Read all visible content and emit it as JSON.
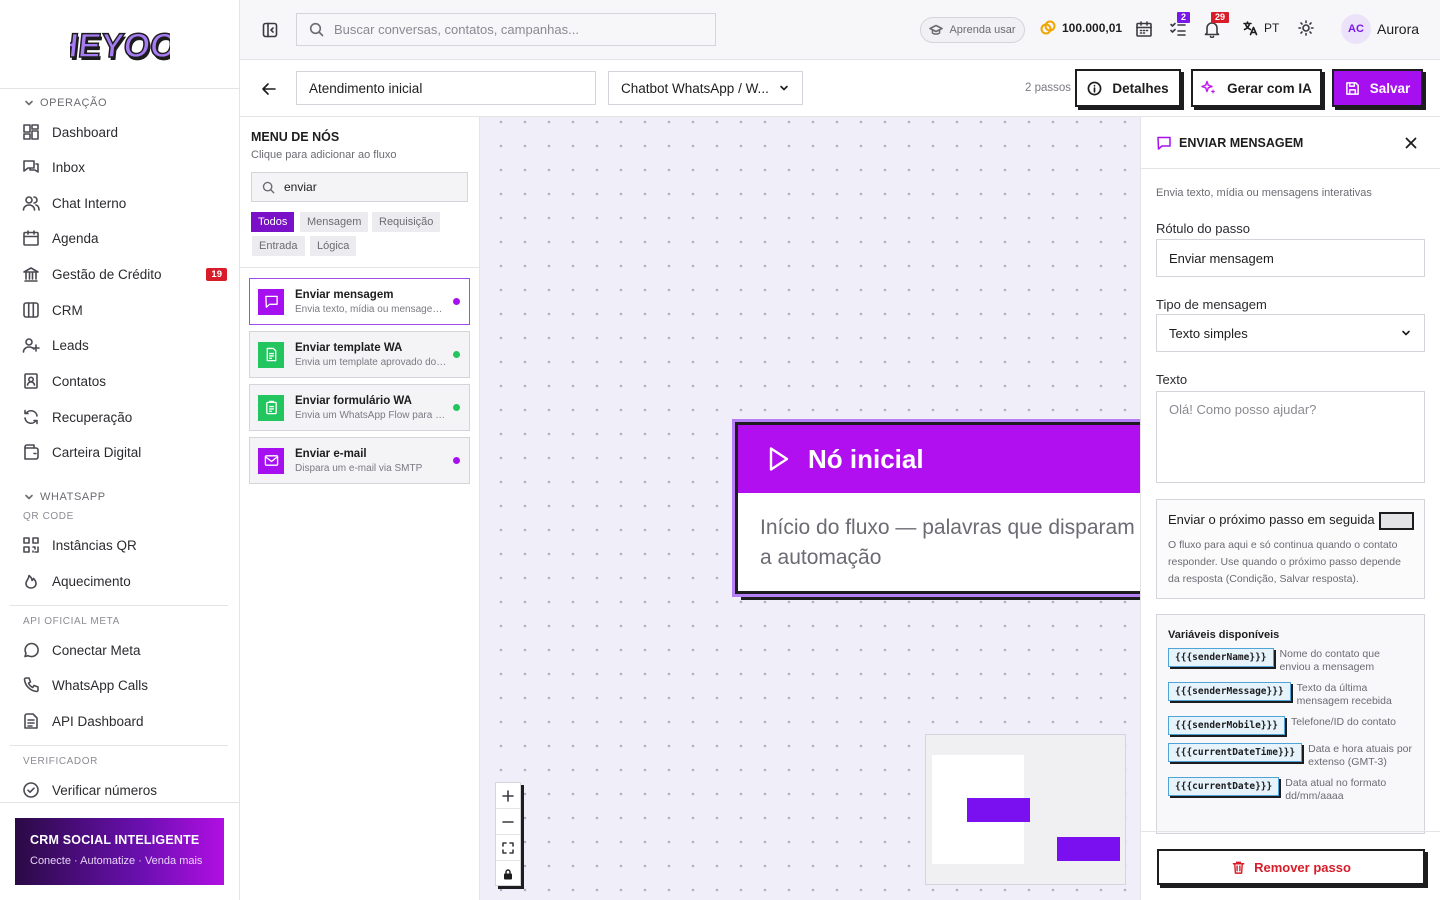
{
  "brand": {
    "logo": "HEYOO"
  },
  "colors": {
    "accent": "#a610f0",
    "accent_dark": "#7a10c8",
    "danger": "#d71d2a"
  },
  "sidebar": {
    "sections": [
      {
        "title": "OPERAÇÃO"
      },
      {
        "title": "WHATSAPP"
      }
    ],
    "subtitles": [
      "QR CODE",
      "API OFICIAL META",
      "VERIFICADOR"
    ],
    "items": [
      {
        "label": "Dashboard",
        "icon": "dashboard-icon"
      },
      {
        "label": "Inbox",
        "icon": "inbox-icon"
      },
      {
        "label": "Chat Interno",
        "icon": "users-icon"
      },
      {
        "label": "Agenda",
        "icon": "calendar-icon"
      },
      {
        "label": "Gestão de Crédito",
        "icon": "bank-icon",
        "badge": "19"
      },
      {
        "label": "CRM",
        "icon": "columns-icon"
      },
      {
        "label": "Leads",
        "icon": "user-plus-icon"
      },
      {
        "label": "Contatos",
        "icon": "contact-icon"
      },
      {
        "label": "Recuperação",
        "icon": "refresh-icon"
      },
      {
        "label": "Carteira Digital",
        "icon": "wallet-icon"
      },
      {
        "label": "Instâncias QR",
        "icon": "qr-icon"
      },
      {
        "label": "Aquecimento",
        "icon": "flame-icon"
      },
      {
        "label": "Conectar Meta",
        "icon": "whatsapp-icon"
      },
      {
        "label": "WhatsApp Calls",
        "icon": "phone-icon"
      },
      {
        "label": "API Dashboard",
        "icon": "api-icon"
      },
      {
        "label": "Verificar números",
        "icon": "check-circle-icon"
      }
    ],
    "promo": {
      "title": "CRM SOCIAL INTELIGENTE",
      "subtitle": "Conecte · Automatize · Venda mais"
    }
  },
  "topbar": {
    "search_placeholder": "Buscar conversas, contatos, campanhas...",
    "learn_label": "Aprenda usar",
    "coins": "100.000,01",
    "tasks_badge": "2",
    "notifications_badge": "29",
    "language": "PT",
    "user_initials": "AC",
    "user_name": "Aurora"
  },
  "flow": {
    "name": "Atendimento inicial",
    "type": "Chatbot WhatsApp / W...",
    "steps": "2 passos",
    "details_label": "Detalhes",
    "ai_label": "Gerar com IA",
    "save_label": "Salvar"
  },
  "node_menu": {
    "title": "MENU DE NÓS",
    "subtitle": "Clique para adicionar ao fluxo",
    "search_value": "enviar",
    "filters": [
      "Todos",
      "Mensagem",
      "Requisição",
      "Entrada",
      "Lógica"
    ],
    "active_filter": "Todos",
    "nodes": [
      {
        "title": "Enviar mensagem",
        "desc": "Envia texto, mídia ou mensagens interativas",
        "icon": "message-icon",
        "color": "#a610f0",
        "dot": "#a610f0"
      },
      {
        "title": "Enviar template WA",
        "desc": "Envia um template aprovado do WhatsApp",
        "icon": "document-icon",
        "color": "#22c55e",
        "dot": "#22c55e"
      },
      {
        "title": "Enviar formulário WA",
        "desc": "Envia um WhatsApp Flow para coletar dados",
        "icon": "clipboard-icon",
        "color": "#22c55e",
        "dot": "#22c55e"
      },
      {
        "title": "Enviar e-mail",
        "desc": "Dispara um e-mail via SMTP",
        "icon": "mail-icon",
        "color": "#a610f0",
        "dot": "#a610f0"
      }
    ]
  },
  "canvas": {
    "start_node": {
      "title": "Nó inicial",
      "desc": "Início do fluxo — palavras que disparam a automação"
    }
  },
  "props": {
    "title": "ENVIAR MENSAGEM",
    "desc": "Envia texto, mídia ou mensagens interativas",
    "step_label_title": "Rótulo do passo",
    "step_label_value": "Enviar mensagem",
    "msg_type_title": "Tipo de mensagem",
    "msg_type_value": "Texto simples",
    "text_title": "Texto",
    "text_placeholder": "Olá! Como posso ajudar?",
    "next_title": "Enviar o próximo passo em seguida",
    "next_help": "O fluxo para aqui e só continua quando o contato responder. Use quando o próximo passo depende da resposta (Condição, Salvar resposta).",
    "vars_title": "Variáveis disponíveis",
    "vars": [
      {
        "code": "{{{senderName}}}",
        "desc": "Nome do contato que enviou a mensagem"
      },
      {
        "code": "{{{senderMessage}}}",
        "desc": "Texto da última mensagem recebida"
      },
      {
        "code": "{{{senderMobile}}}",
        "desc": "Telefone/ID do contato"
      },
      {
        "code": "{{{currentDateTime}}}",
        "desc": "Data e hora atuais por extenso (GMT-3)"
      },
      {
        "code": "{{{currentDate}}}",
        "desc": "Data atual no formato dd/mm/aaaa"
      }
    ],
    "remove_label": "Remover passo"
  }
}
